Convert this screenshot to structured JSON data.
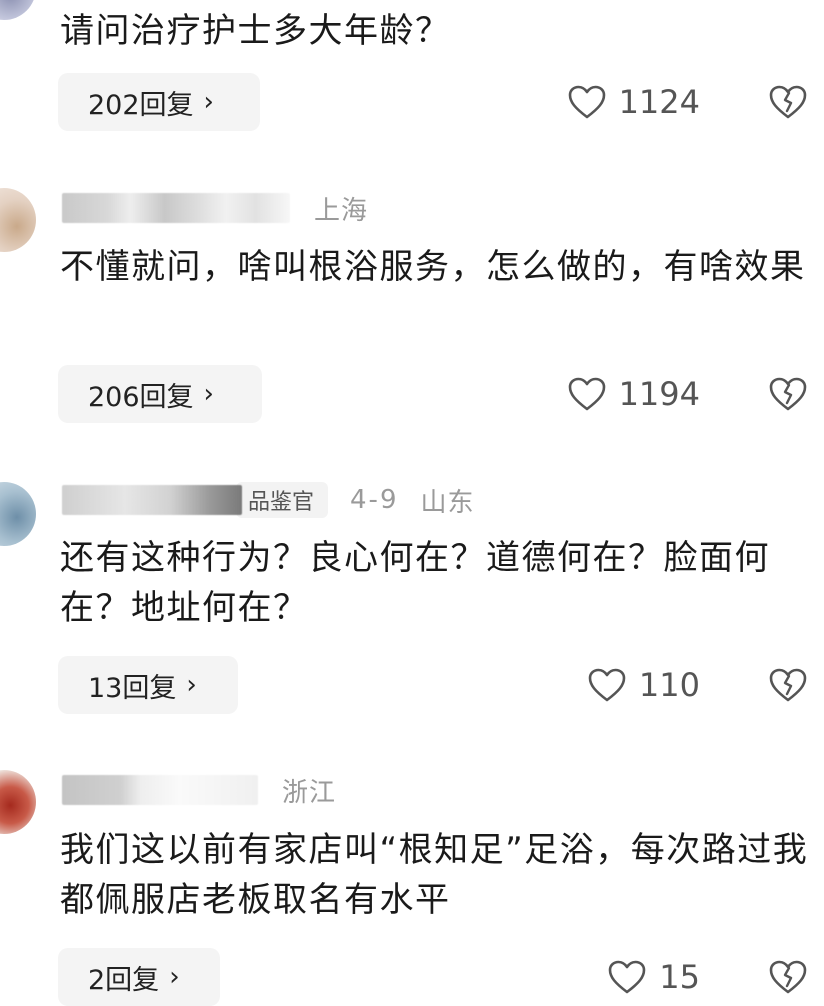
{
  "comments": [
    {
      "location": "",
      "badge": "",
      "date": "",
      "text": "请问治疗护士多大年龄？",
      "reply_label": "202回复",
      "likes": "1124"
    },
    {
      "location": "上海",
      "badge": "",
      "date": "",
      "text": "不懂就问，啥叫根浴服务，怎么做的，有啥效果",
      "reply_label": "206回复",
      "likes": "1194"
    },
    {
      "location": "山东",
      "badge": "品鉴官",
      "date": "4-9",
      "text": "还有这种行为？良心何在？道德何在？脸面何在？地址何在？",
      "reply_label": "13回复",
      "likes": "110"
    },
    {
      "location": "浙江",
      "badge": "",
      "date": "",
      "text": "我们这以前有家店叫“根知足”足浴，每次路过我都佩服店老板取名有水平",
      "reply_label": "2回复",
      "likes": "15"
    }
  ],
  "icons": {
    "chevron": "›",
    "like": "heart-outline-icon",
    "dislike": "broken-heart-icon"
  },
  "colors": {
    "reply_bg": "#f4f4f4",
    "meta_gray": "#9a9a9a",
    "text": "#1a1a1a"
  }
}
